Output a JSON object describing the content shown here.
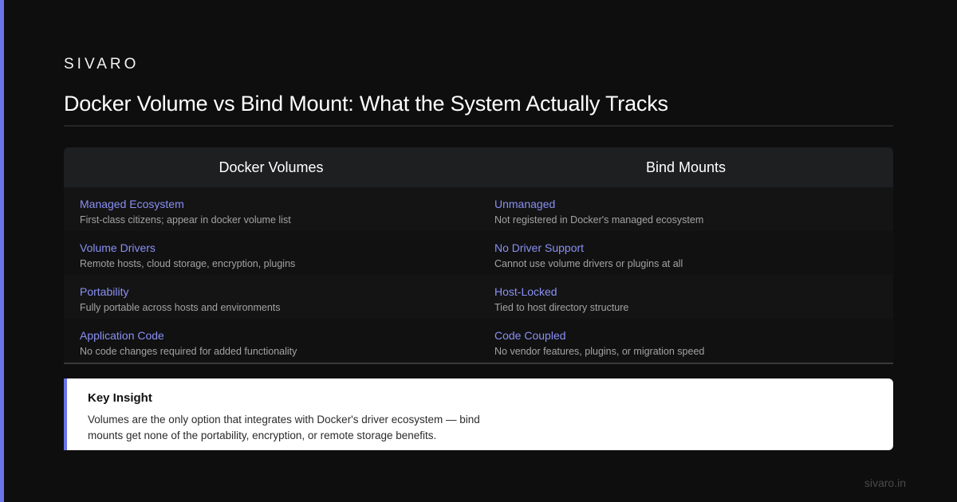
{
  "brand": "SIVARO",
  "title": "Docker Volume vs Bind Mount: What the System Actually Tracks",
  "columns": {
    "left": "Docker Volumes",
    "right": "Bind Mounts"
  },
  "rows": [
    {
      "left_title": "Managed Ecosystem",
      "left_desc": "First-class citizens; appear in docker volume list",
      "right_title": "Unmanaged",
      "right_desc": "Not registered in Docker's managed ecosystem"
    },
    {
      "left_title": "Volume Drivers",
      "left_desc": "Remote hosts, cloud storage, encryption, plugins",
      "right_title": "No Driver Support",
      "right_desc": "Cannot use volume drivers or plugins at all"
    },
    {
      "left_title": "Portability",
      "left_desc": "Fully portable across hosts and environments",
      "right_title": "Host-Locked",
      "right_desc": "Tied to host directory structure"
    },
    {
      "left_title": "Application Code",
      "left_desc": "No code changes required for added functionality",
      "right_title": "Code Coupled",
      "right_desc": "No vendor features, plugins, or migration speed"
    }
  ],
  "insight": {
    "title": "Key Insight",
    "text": "Volumes are the only option that integrates with Docker's driver ecosystem — bind mounts get none of the portability, encryption, or remote storage benefits."
  },
  "footer": "sivaro.in",
  "colors": {
    "accent": "#6b74e8",
    "feature_title": "#8a90f2",
    "background": "#0e0e0e"
  }
}
